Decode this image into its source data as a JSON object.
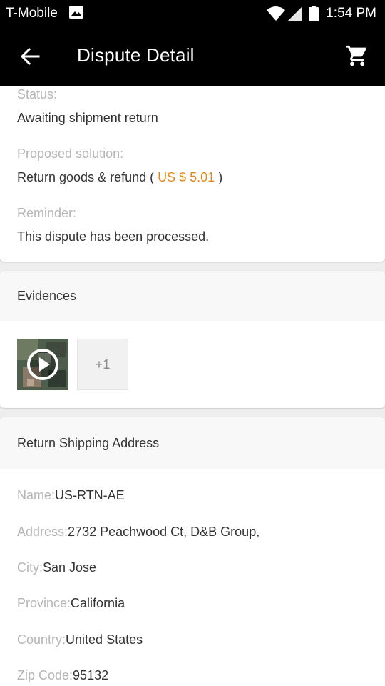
{
  "status_bar": {
    "carrier": "T-Mobile",
    "time": "1:54 PM"
  },
  "app_bar": {
    "title": "Dispute Detail"
  },
  "dispute": {
    "status_label": "Status:",
    "status_value": "Awaiting shipment return",
    "solution_label": "Proposed solution:",
    "solution_prefix": "Return goods & refund (",
    "solution_price": "US $ 5.01",
    "solution_suffix": ")",
    "reminder_label": "Reminder:",
    "reminder_value": "This dispute has been processed."
  },
  "evidences": {
    "header": "Evidences",
    "more_count": "+1"
  },
  "return_address": {
    "header": "Return Shipping Address",
    "rows": [
      {
        "key": "Name:",
        "value": "US-RTN-AE"
      },
      {
        "key": "Address:",
        "value": "2732 Peachwood Ct, D&B Group,"
      },
      {
        "key": "City:",
        "value": "San Jose"
      },
      {
        "key": "Province:",
        "value": "California"
      },
      {
        "key": "Country:",
        "value": "United States"
      },
      {
        "key": "Zip Code:",
        "value": "95132"
      }
    ]
  },
  "colors": {
    "price_accent": "#e08a1e",
    "bar_background": "#000000"
  }
}
